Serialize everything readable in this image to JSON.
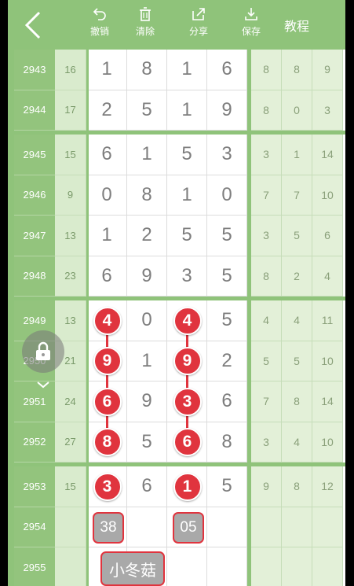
{
  "toolbar": {
    "undo_label": "撤销",
    "clear_label": "清除",
    "share_label": "分享",
    "save_label": "保存",
    "tutorial_label": "教程",
    "icons": {
      "back": "back-chevron-icon",
      "undo": "undo-icon",
      "clear": "trash-icon",
      "share": "share-icon",
      "save": "download-icon",
      "lock": "lock-icon"
    }
  },
  "colors": {
    "header": "#8fc37a",
    "ball": "#e0343e",
    "tag_bg": "#a9a9a9"
  },
  "rows": [
    {
      "period": "2943",
      "sum": "16",
      "nums": [
        "1",
        "8",
        "1",
        "6"
      ],
      "stats": [
        "8",
        "8",
        "9"
      ]
    },
    {
      "period": "2944",
      "sum": "17",
      "nums": [
        "2",
        "5",
        "1",
        "9"
      ],
      "stats": [
        "8",
        "0",
        "3"
      ]
    },
    {
      "period": "2945",
      "sum": "15",
      "nums": [
        "6",
        "1",
        "5",
        "3"
      ],
      "stats": [
        "3",
        "1",
        "14"
      ]
    },
    {
      "period": "2946",
      "sum": "9",
      "nums": [
        "0",
        "8",
        "1",
        "0"
      ],
      "stats": [
        "7",
        "7",
        "10"
      ]
    },
    {
      "period": "2947",
      "sum": "13",
      "nums": [
        "1",
        "2",
        "5",
        "5"
      ],
      "stats": [
        "3",
        "5",
        "6"
      ]
    },
    {
      "period": "2948",
      "sum": "23",
      "nums": [
        "6",
        "9",
        "3",
        "5"
      ],
      "stats": [
        "8",
        "2",
        "4"
      ]
    },
    {
      "period": "2949",
      "sum": "13",
      "nums": [
        "4",
        "0",
        "4",
        "5"
      ],
      "stats": [
        "4",
        "4",
        "11"
      ]
    },
    {
      "period": "2950",
      "sum": "21",
      "nums": [
        "9",
        "1",
        "9",
        "2"
      ],
      "stats": [
        "5",
        "5",
        "10"
      ]
    },
    {
      "period": "2951",
      "sum": "24",
      "nums": [
        "6",
        "9",
        "3",
        "6"
      ],
      "stats": [
        "7",
        "8",
        "14"
      ]
    },
    {
      "period": "2952",
      "sum": "27",
      "nums": [
        "8",
        "5",
        "6",
        "8"
      ],
      "stats": [
        "3",
        "4",
        "10"
      ]
    },
    {
      "period": "2953",
      "sum": "15",
      "nums": [
        "3",
        "6",
        "1",
        "5"
      ],
      "stats": [
        "9",
        "8",
        "12"
      ]
    },
    {
      "period": "2954",
      "sum": "",
      "nums": [
        "",
        "",
        "",
        ""
      ],
      "stats": [
        "",
        "",
        ""
      ]
    },
    {
      "period": "2955",
      "sum": "",
      "nums": [
        "",
        "",
        "",
        ""
      ],
      "stats": [
        "",
        "",
        ""
      ]
    }
  ],
  "annotations": {
    "tags": [
      "38",
      "05"
    ],
    "name_tag": "小冬菇"
  }
}
